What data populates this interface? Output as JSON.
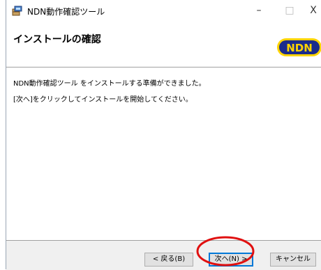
{
  "window": {
    "title": "NDN動作確認ツール",
    "controls": {
      "minimize": "–",
      "maximize": "□",
      "close": "X"
    }
  },
  "header": {
    "title": "インストールの確認",
    "logo_text": "NDN"
  },
  "content": {
    "line1": "NDN動作確認ツール をインストールする準備ができました。",
    "line2": "[次へ]をクリックしてインストールを開始してください。"
  },
  "footer": {
    "back_label": "< 戻る(B)",
    "next_label": "次へ(N) >",
    "cancel_label": "キャンセル"
  },
  "colors": {
    "logo_blue": "#1a2b8c",
    "logo_yellow": "#ffd400",
    "highlight_red": "#e01010"
  }
}
